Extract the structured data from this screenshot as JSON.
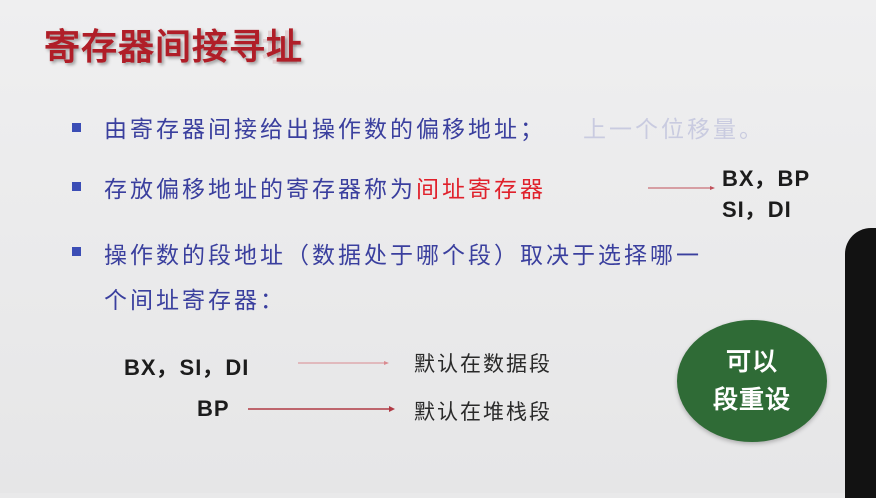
{
  "title": "寄存器间接寻址",
  "title_ghost": "址",
  "bullets": {
    "b1": {
      "text": "由寄存器间接给出操作数的偏移地址；",
      "faded_text": "上一个位移量。"
    },
    "b2": {
      "text_before": "存放偏移地址的寄存器称为",
      "text_highlight": "间址寄存器"
    },
    "b3": {
      "line1": "操作数的段地址（数据处于哪个段）取决于选择哪一",
      "line2": "个间址寄存器："
    }
  },
  "registers_side": {
    "line1": "BX，BP",
    "line2": "SI，DI"
  },
  "mappings": [
    {
      "regs": "BX，SI，DI",
      "segment": "默认在数据段"
    },
    {
      "regs": "BP",
      "segment": "默认在堆栈段"
    }
  ],
  "badge": {
    "line1": "可以",
    "line2": "段重设"
  },
  "colors": {
    "title": "#b01e28",
    "bullet_text": "#3a3f9e",
    "highlight": "#e0212b",
    "badge": "#2f6b36",
    "arrow": "#c0505a"
  }
}
